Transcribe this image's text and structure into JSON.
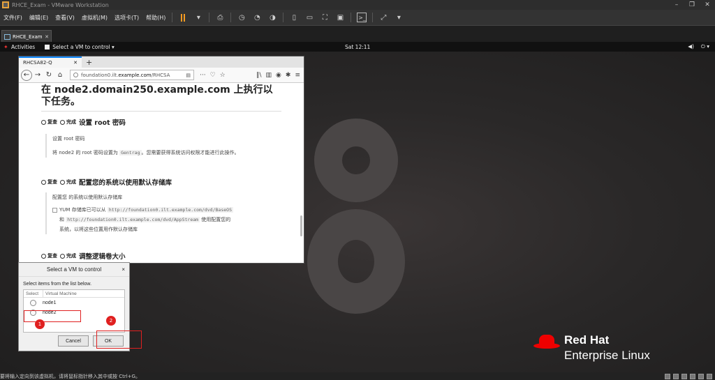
{
  "window": {
    "title": "RHCE_Exam - VMware Workstation"
  },
  "menu": {
    "items": [
      "文件(F)",
      "编辑(E)",
      "查看(V)",
      "虚拟机(M)",
      "选项卡(T)",
      "帮助(H)"
    ]
  },
  "vm_tab": {
    "label": "RHCE_Exam",
    "close": "✕"
  },
  "gnome": {
    "activities": "Activities",
    "select_vm": "Select a VM to control ▾",
    "clock": "Sat 12:11"
  },
  "browser": {
    "tab_title": "RHCSA82-Q",
    "url_prefix": "foundation0.ilt.",
    "url_host": "example.com",
    "url_path": "/RHCSA",
    "heading": "在 node2.domain250.example.com 上执行以下任务。",
    "check_label": "复查",
    "done_label": "完成",
    "tasks": [
      {
        "title": "设置 root 密码",
        "desc_title": "设置 root 密码",
        "desc_before": "将 node2 的 root 密码设置为 ",
        "desc_code": "Gentrag",
        "desc_after": "。您需要获得系统访问权限才能进行此操作。"
      },
      {
        "title": "配置您的系统以使用默认存储库",
        "desc_title": "配置您 的系统以使用默认存储库",
        "line1": "YUM 存储库已可以从 ",
        "code1": "http://foundation0.ilt.example.com/dvd/BaseOS",
        "line2": "和 ",
        "code2": "http://foundation0.ilt.example.com/dvd/AppStream",
        "line2_after": " 使用配置您的",
        "line3": "系统，以将这些位置用作默认存储库"
      },
      {
        "title": "调整逻辑卷大小"
      }
    ]
  },
  "dialog": {
    "title": "Select a VM to control",
    "close": "×",
    "hint": "Select items from the list below.",
    "col_select": "Select",
    "col_vm": "Virtual Machine",
    "vms": [
      "node1",
      "node2"
    ],
    "cancel": "Cancel",
    "ok": "OK"
  },
  "annotations": {
    "badge1": "1",
    "badge2": "2"
  },
  "brand": {
    "line1": "Red Hat",
    "line2": "Enterprise Linux"
  },
  "statusbar": {
    "text": "要将输入定向到该虚拟机，请将鼠标指针移入其中或按 Ctrl+G。"
  }
}
